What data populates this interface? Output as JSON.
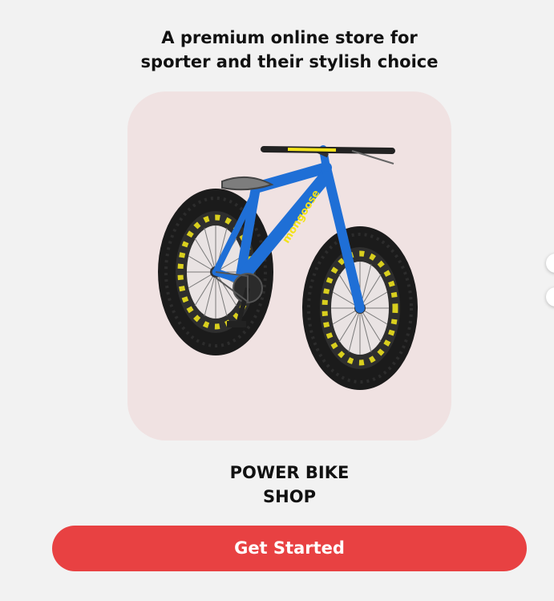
{
  "intro": {
    "tagline_line1": "A premium online store for",
    "tagline_line2": "sporter and their stylish choice"
  },
  "product": {
    "image_name": "blue-fat-tire-bike",
    "frame_brand_text": "mongoose",
    "card_color": "#f0e2e2",
    "frame_color": "#1f6fd6",
    "accent_color": "#f2e21a"
  },
  "shop": {
    "title_line1": "POWER BIKE",
    "title_line2": "SHOP"
  },
  "cta": {
    "label": "Get Started",
    "color": "#e84142"
  },
  "pager": {
    "dots": 2
  }
}
